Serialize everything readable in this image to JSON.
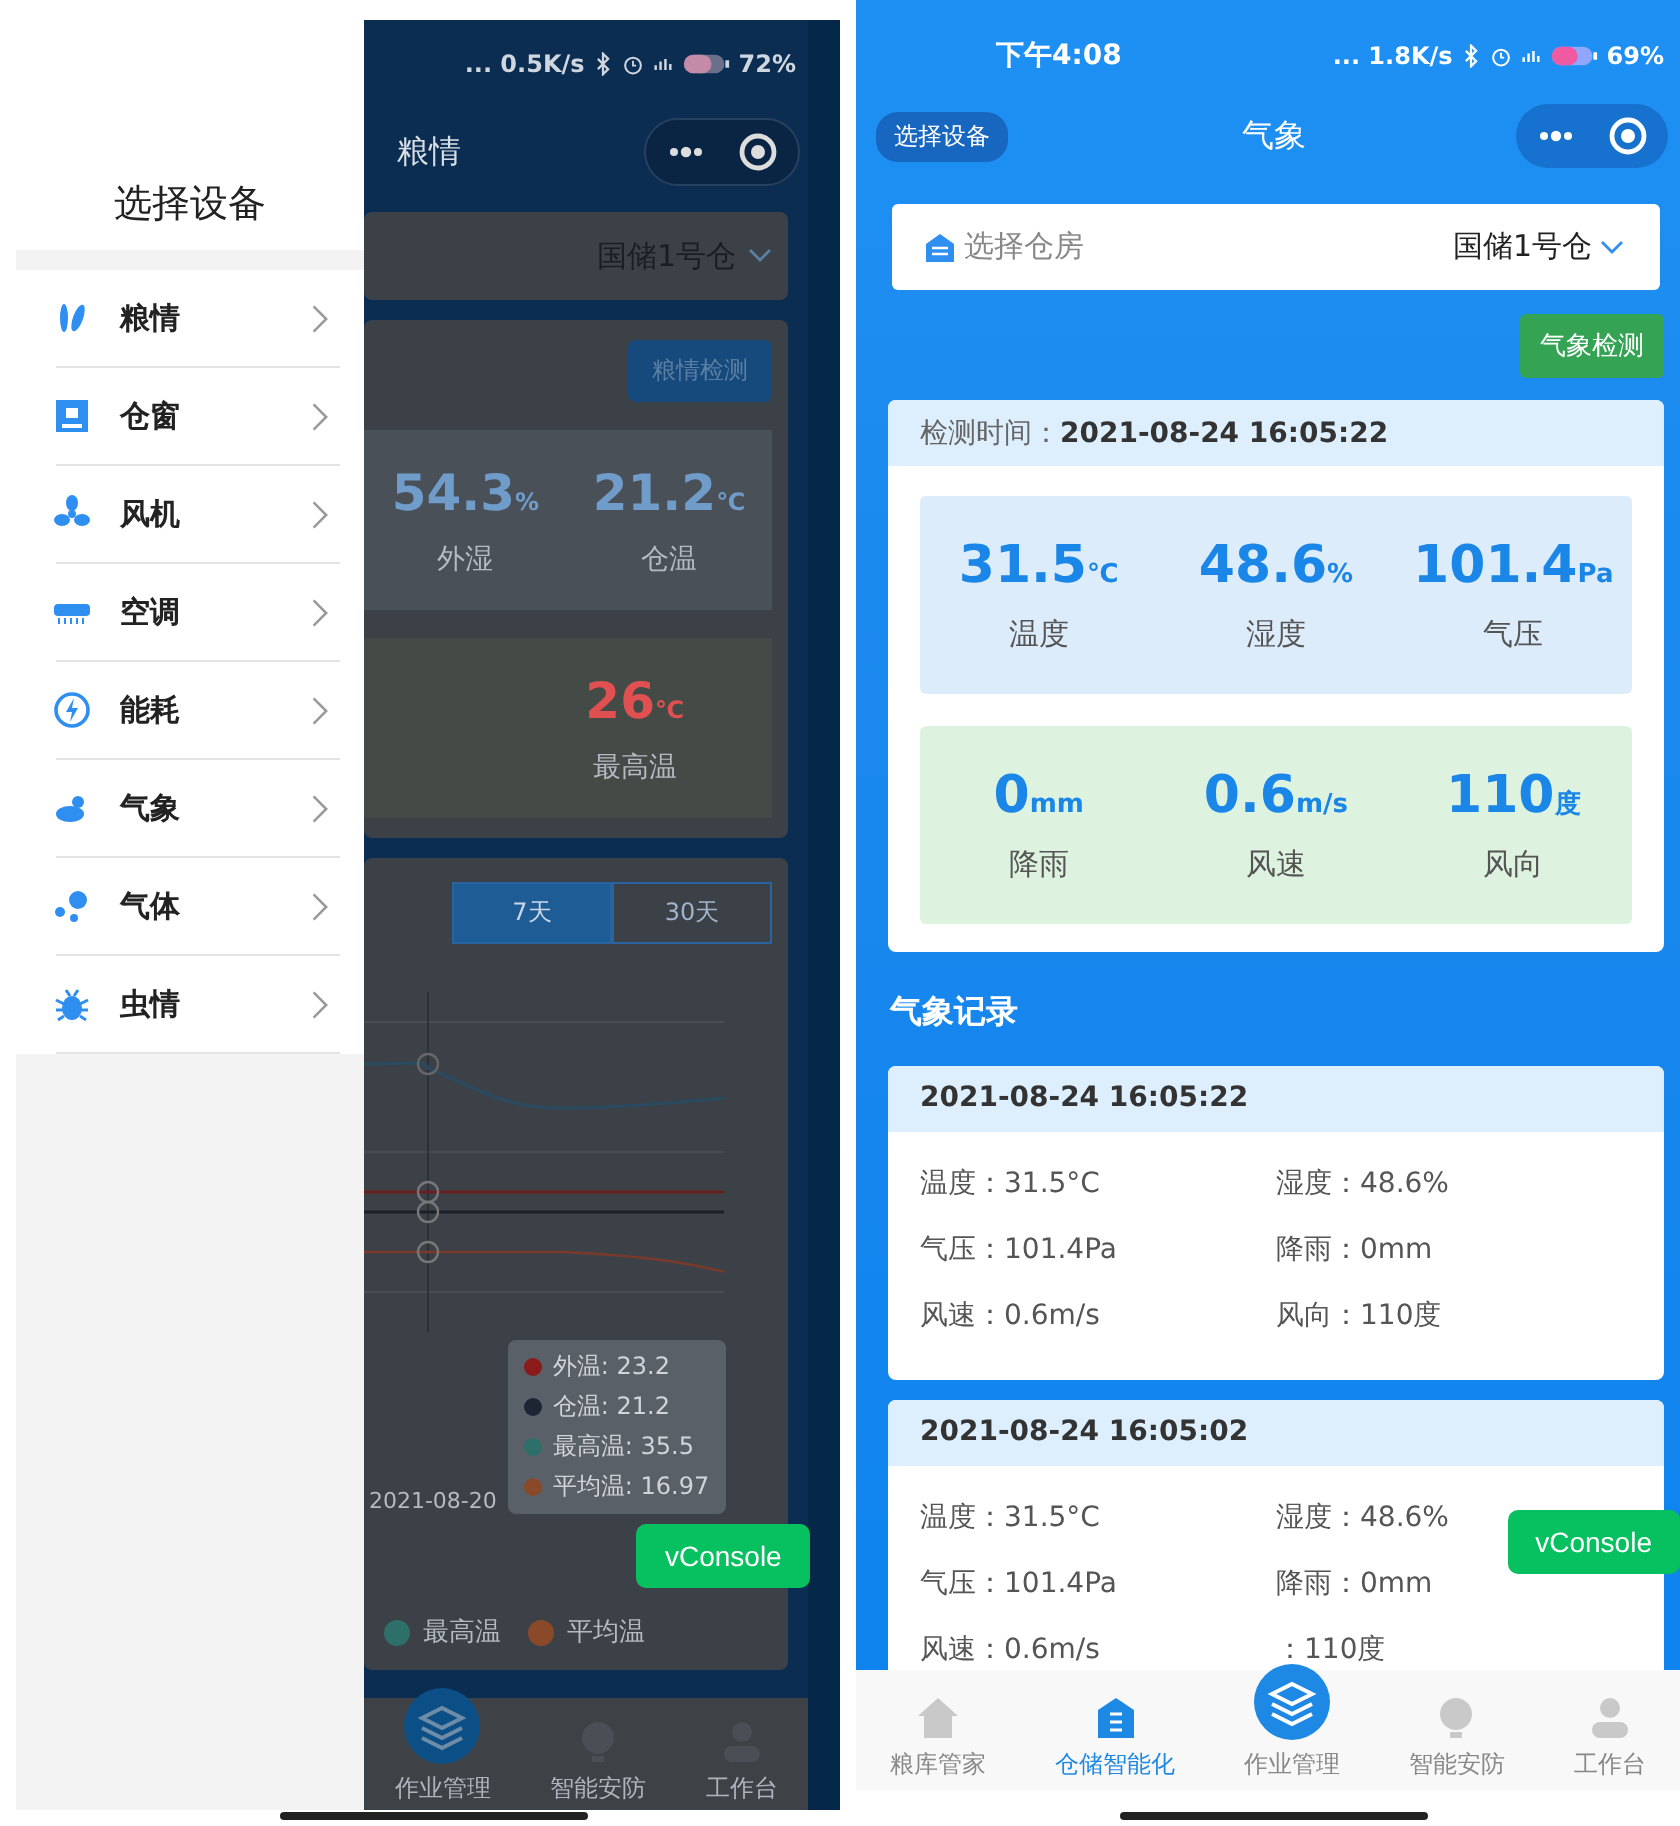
{
  "left_phone": {
    "drawer": {
      "title": "选择设备",
      "items": [
        {
          "label": "粮情",
          "kind": "grain"
        },
        {
          "label": "仓窗",
          "kind": "window"
        },
        {
          "label": "风机",
          "kind": "fan"
        },
        {
          "label": "空调",
          "kind": "aircon"
        },
        {
          "label": "能耗",
          "kind": "energy"
        },
        {
          "label": "气象",
          "kind": "weather"
        },
        {
          "label": "气体",
          "kind": "gas"
        },
        {
          "label": "虫情",
          "kind": "bug"
        }
      ]
    },
    "status_bar": {
      "speed": "... 0.5K/s",
      "battery": "72%"
    },
    "page": {
      "title": "粮情",
      "warehouse": "国储1号仓",
      "detect_button": "粮情检测",
      "stats": [
        {
          "value": "54.3",
          "unit": "%",
          "label": "外湿"
        },
        {
          "value": "21.2",
          "unit": "℃",
          "label": "仓温"
        }
      ],
      "max_temp": {
        "value": "26",
        "unit": "℃",
        "label": "最高温"
      },
      "range_tabs": [
        {
          "label": "7天",
          "selected": true
        },
        {
          "label": "30天",
          "selected": false
        }
      ],
      "tooltip": [
        {
          "text": "外温: 23.2",
          "color": "#8b1a1a"
        },
        {
          "text": "仓温: 21.2",
          "color": "#1b2533"
        },
        {
          "text": "最高温: 35.5",
          "color": "#2f6f6a"
        },
        {
          "text": "平均温: 16.97",
          "color": "#8a4a2a"
        }
      ],
      "x_label": "2021-08-20",
      "legend": [
        {
          "label": "最高温",
          "color": "#2f6f6a"
        },
        {
          "label": "平均温",
          "color": "#8a4a2a"
        }
      ],
      "nav": [
        {
          "label": "作业管理",
          "kind": "layers"
        },
        {
          "label": "智能安防",
          "kind": "bulb"
        },
        {
          "label": "工作台",
          "kind": "person"
        }
      ]
    },
    "vconsole": "vConsole"
  },
  "right_phone": {
    "status_bar": {
      "time": "下午4:08",
      "speed": "... 1.8K/s",
      "battery": "69%"
    },
    "select_device_button": "选择设备",
    "title": "气象",
    "warehouse": {
      "label": "选择仓房",
      "value": "国储1号仓"
    },
    "detect_button": "气象检测",
    "detection": {
      "label": "检测时间：",
      "time": "2021-08-24 16:05:22",
      "groups": [
        {
          "color": "#dcecfb",
          "readings": [
            {
              "value": "31.5",
              "unit": "℃",
              "label": "温度"
            },
            {
              "value": "48.6",
              "unit": "%",
              "label": "湿度"
            },
            {
              "value": "101.4",
              "unit": "Pa",
              "label": "气压"
            }
          ]
        },
        {
          "color": "#def3df",
          "readings": [
            {
              "value": "0",
              "unit": "mm",
              "label": "降雨"
            },
            {
              "value": "0.6",
              "unit": "m/s",
              "label": "风速"
            },
            {
              "value": "110",
              "unit": "度",
              "label": "风向"
            }
          ]
        }
      ]
    },
    "records_title": "气象记录",
    "records": [
      {
        "time": "2021-08-24 16:05:22",
        "fields": [
          "温度：31.5°C",
          "湿度：48.6%",
          "气压：101.4Pa",
          "降雨：0mm",
          "风速：0.6m/s",
          "风向：110度"
        ]
      },
      {
        "time": "2021-08-24 16:05:02",
        "fields": [
          "温度：31.5°C",
          "湿度：48.6%",
          "气压：101.4Pa",
          "降雨：0mm",
          "风速：0.6m/s",
          "：110度"
        ]
      }
    ],
    "nav": [
      {
        "label": "粮库管家",
        "kind": "home",
        "selected": false
      },
      {
        "label": "仓储智能化",
        "kind": "warehouse",
        "selected": true
      },
      {
        "label": "作业管理",
        "kind": "layers",
        "selected": false
      },
      {
        "label": "智能安防",
        "kind": "bulb",
        "selected": false
      },
      {
        "label": "工作台",
        "kind": "person",
        "selected": false
      }
    ],
    "vconsole": "vConsole"
  }
}
